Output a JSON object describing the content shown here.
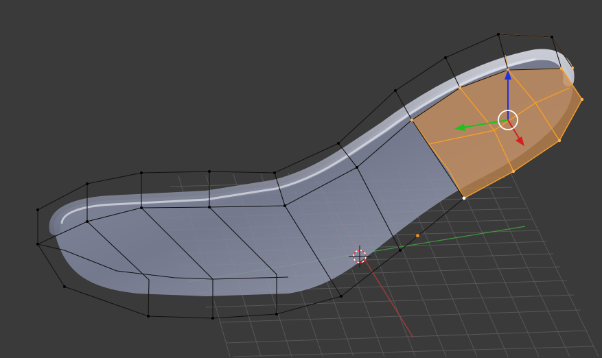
{
  "viewport": {
    "colors": {
      "background": "#3a3a3a",
      "grid": "#555555",
      "x_axis": "#b03a3a",
      "y_axis": "#3f9a3f",
      "mesh_fill": "#8a8fa8",
      "cage_edge": "#111111",
      "selected_edge": "#f39c2a",
      "selected_face": "#c88a50",
      "selected_vertex": "#ffffff",
      "origin": "#e5912d"
    },
    "manipulator": {
      "x_color": "#d02020",
      "y_color": "#20c020",
      "z_color": "#2030e0",
      "ring_color": "#ffffff"
    },
    "cursor_3d": {
      "colors": [
        "#ff3333",
        "#ffffff"
      ]
    }
  }
}
